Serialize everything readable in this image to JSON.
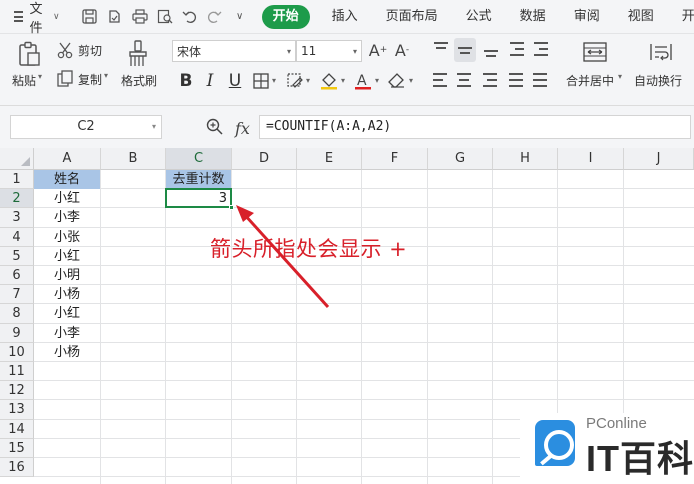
{
  "menubar": {
    "file_label": "文件",
    "tabs": [
      {
        "label": "开始",
        "active": true
      },
      {
        "label": "插入",
        "active": false
      },
      {
        "label": "页面布局",
        "active": false
      },
      {
        "label": "公式",
        "active": false
      },
      {
        "label": "数据",
        "active": false
      },
      {
        "label": "审阅",
        "active": false
      },
      {
        "label": "视图",
        "active": false
      },
      {
        "label": "开发",
        "active": false
      }
    ]
  },
  "ribbon": {
    "paste_label": "粘贴",
    "cut_label": "剪切",
    "copy_label": "复制",
    "format_painter_label": "格式刷",
    "font_name": "宋体",
    "font_size": "11",
    "merge_center_label": "合并居中",
    "wrap_text_label": "自动换行"
  },
  "formula_bar": {
    "name_box": "C2",
    "fx_label": "fx",
    "formula": "=COUNTIF(A:A,A2)"
  },
  "sheet": {
    "columns": [
      "A",
      "B",
      "C",
      "D",
      "E",
      "F",
      "G",
      "H",
      "I",
      "J"
    ],
    "rows": [
      "1",
      "2",
      "3",
      "4",
      "5",
      "6",
      "7",
      "8",
      "9",
      "10",
      "11",
      "12",
      "13",
      "14",
      "15",
      "16"
    ],
    "selected_column": "C",
    "selected_row": "2",
    "col_a_header": "姓名",
    "col_a_values": [
      "小红",
      "小李",
      "小张",
      "小红",
      "小明",
      "小杨",
      "小红",
      "小李",
      "小杨"
    ],
    "col_c_header": "去重计数",
    "c2_value": "3",
    "header_fill": "#a9c5e6",
    "active_cell_border": "#1d8a45"
  },
  "annotation": {
    "text": "箭头所指处会显示 +",
    "color": "#d8202a"
  },
  "watermark": {
    "brand": "PConline",
    "name": "IT百科"
  }
}
